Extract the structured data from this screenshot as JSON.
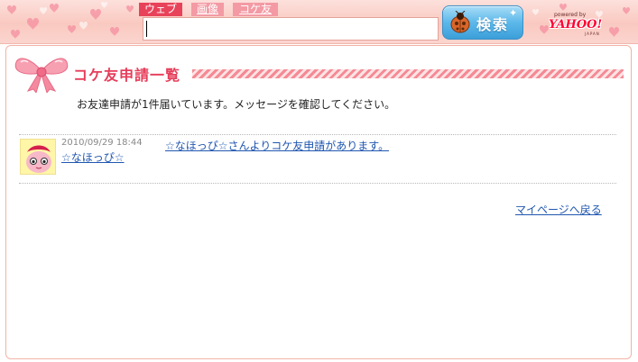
{
  "header": {
    "tabs": [
      {
        "label": "ウェブ",
        "active": true
      },
      {
        "label": "画像",
        "active": false
      },
      {
        "label": "コケ友",
        "active": false
      }
    ],
    "search": {
      "value": "",
      "placeholder": ""
    },
    "search_button_label": "検索",
    "yahoo": {
      "powered_by": "powered by",
      "logo": "YAHOO!",
      "region": "JAPAN"
    }
  },
  "main": {
    "title": "コケ友申請一覧",
    "notice": "お友達申請が1件届いています。メッセージを確認してください。",
    "requests": [
      {
        "date": "2010/09/29 18:44",
        "name": "☆なほっぴ☆",
        "message": "☆なほっぴ☆さんよりコケ友申請があります。"
      }
    ],
    "mypage_link": "マイページへ戻る"
  },
  "colors": {
    "accent": "#e63e5a",
    "link": "#2157b0",
    "header_bg": "#f9c9c0",
    "search_button": "#5cb8ea"
  },
  "icons": [
    "heart-icon",
    "ladybug-icon",
    "ribbon-icon",
    "avatar"
  ]
}
